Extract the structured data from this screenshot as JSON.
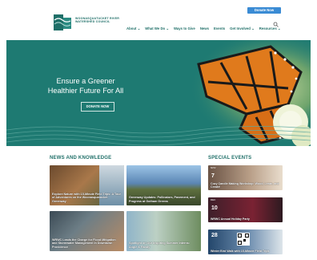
{
  "header": {
    "org_name": "WOONASQUATUCKET RIVER WATERSHED COUNCIL",
    "donate_label": "Donate Now",
    "nav": [
      "About ⌄",
      "What We Do ⌄",
      "Ways to Give",
      "News",
      "Events",
      "Get Involved ⌄",
      "Resources ⌄"
    ]
  },
  "hero": {
    "title": "Ensure a Greener Healthier Future For All",
    "button_label": "DONATE NOW"
  },
  "news": {
    "heading": "NEWS AND KNOWLEDGE",
    "items": [
      {
        "caption": "Explore Nature with 15-Minute Field Trips: A Tour of Adventures on the Woonasquatucket Greenway"
      },
      {
        "caption": "Greenway Updates: Pollinators, Pavement, and Progress at Gotham Greens"
      },
      {
        "caption": "WRWC Leads the Charge for Flood Mitigation and Stormwater Management in Downtown Providence"
      },
      {
        "caption": "Spotlight on Our Inspiring Summer Interns: Angie & Randy"
      }
    ]
  },
  "events": {
    "heading": "SPECIAL EVENTS",
    "items": [
      {
        "month": "NOV",
        "day": "7",
        "caption": "Cozy Candle Making Workshop: Wood, Learn, and Create!"
      },
      {
        "month": "DEC",
        "day": "10",
        "caption": "WRWC Annual Holiday Party"
      },
      {
        "month": "",
        "day": "28",
        "caption": "Winter Bird Walk with 15-Minute Field Trips"
      }
    ]
  },
  "colors": {
    "brand": "#1f6f68",
    "hero": "#1e7a72",
    "donate": "#3a8bd4"
  }
}
